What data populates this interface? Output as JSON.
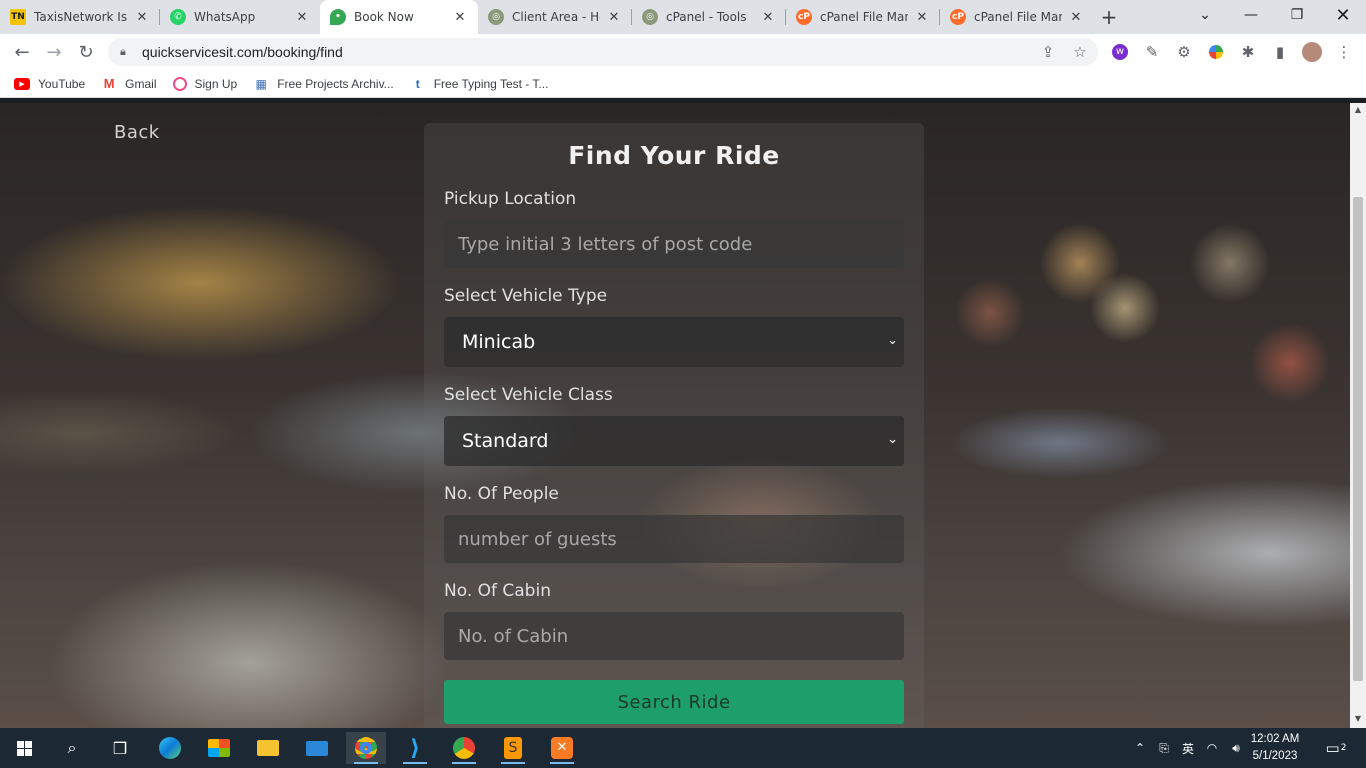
{
  "browser": {
    "tabs": [
      {
        "title": "TaxisNetwork Is C",
        "icon": "tn-icon",
        "active": false
      },
      {
        "title": "WhatsApp",
        "icon": "whatsapp-icon",
        "active": false
      },
      {
        "title": "Book Now",
        "icon": "map-pin-icon",
        "active": true
      },
      {
        "title": "Client Area - Hos",
        "icon": "globe-icon",
        "active": false
      },
      {
        "title": "cPanel - Tools",
        "icon": "globe-icon",
        "active": false
      },
      {
        "title": "cPanel File Mana",
        "icon": "cpanel-icon",
        "active": false
      },
      {
        "title": "cPanel File Mana",
        "icon": "cpanel-icon",
        "active": false
      }
    ],
    "url": "quickservicesit.com/booking/find",
    "bookmarks": [
      {
        "label": "YouTube",
        "icon": "youtube-icon"
      },
      {
        "label": "Gmail",
        "icon": "gmail-icon"
      },
      {
        "label": "Sign Up",
        "icon": "signup-icon"
      },
      {
        "label": "Free Projects Archiv...",
        "icon": "projects-icon"
      },
      {
        "label": "Free Typing Test - T...",
        "icon": "typing-icon"
      }
    ]
  },
  "page": {
    "back_label": "Back",
    "form": {
      "title": "Find Your Ride",
      "pickup_label": "Pickup Location",
      "pickup_placeholder": "Type initial 3 letters of post code",
      "vehicle_type_label": "Select Vehicle Type",
      "vehicle_type_value": "Minicab",
      "vehicle_class_label": "Select Vehicle Class",
      "vehicle_class_value": "Standard",
      "people_label": "No. Of People",
      "people_placeholder": "number of guests",
      "cabin_label": "No. Of Cabin",
      "cabin_placeholder": "No. of Cabin",
      "search_label": "Search Ride"
    }
  },
  "taskbar": {
    "time": "12:02 AM",
    "date": "5/1/2023",
    "notification_count": "2"
  },
  "colors": {
    "accent": "#1e9e6a",
    "tab_bar": "#dee1e6",
    "taskbar": "#1c2833"
  }
}
